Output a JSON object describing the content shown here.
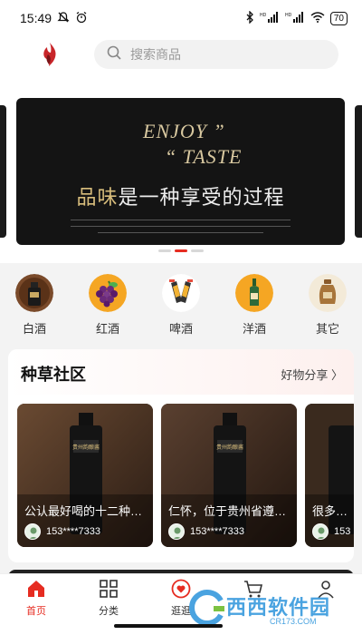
{
  "status": {
    "time": "15:49",
    "battery": "70",
    "hd_label": "HD"
  },
  "search": {
    "placeholder": "搜索商品"
  },
  "banner": {
    "line1": "ENJOY ”",
    "line2": "“ TASTE",
    "cn_highlight": "品味",
    "cn_rest": "是一种享受的过程",
    "active_index": 1,
    "count": 3
  },
  "categories": [
    {
      "label": "白酒",
      "icon": "baijiu-bottle-icon"
    },
    {
      "label": "红酒",
      "icon": "grapes-icon"
    },
    {
      "label": "啤酒",
      "icon": "beer-icon"
    },
    {
      "label": "洋酒",
      "icon": "wine-bottle-icon"
    },
    {
      "label": "其它",
      "icon": "jar-icon"
    }
  ],
  "community": {
    "title": "种草社区",
    "more_label": "好物分享 〉",
    "cards": [
      {
        "title": "公认最好喝的十二种不…",
        "user": "153****7333"
      },
      {
        "title": "仁怀，位于贵州省遵义…",
        "user": "153****7333"
      },
      {
        "title": "很多人…",
        "user": "153"
      }
    ],
    "bottle_label": "贵州韵酿酱"
  },
  "tabbar": {
    "items": [
      {
        "label": "首页",
        "active": true
      },
      {
        "label": "分类",
        "active": false
      },
      {
        "label": "逛逛",
        "active": false
      },
      {
        "label": "",
        "active": false
      },
      {
        "label": "",
        "active": false
      }
    ]
  },
  "watermark": {
    "text": "西西软件园",
    "url": "CR173.COM"
  },
  "colors": {
    "accent": "#e62c21",
    "banner_bg": "#141414",
    "gold": "#d8bd7c"
  }
}
